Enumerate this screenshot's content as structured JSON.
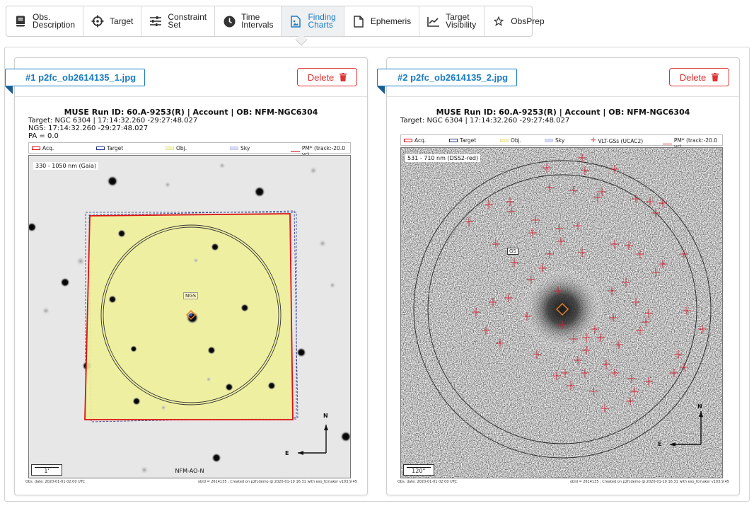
{
  "tabs": [
    {
      "label": "Obs.\nDescription",
      "icon": "book-icon"
    },
    {
      "label": "Target",
      "icon": "crosshair-icon"
    },
    {
      "label": "Constraint\nSet",
      "icon": "sliders-icon"
    },
    {
      "label": "Time\nIntervals",
      "icon": "clock-icon"
    },
    {
      "label": "Finding\nCharts",
      "icon": "image-file-icon"
    },
    {
      "label": "Ephemeris",
      "icon": "file-icon"
    },
    {
      "label": "Target\nVisibility",
      "icon": "line-chart-icon"
    },
    {
      "label": "ObsPrep",
      "icon": "star-icon"
    }
  ],
  "active_tab": "Finding Charts",
  "colors": {
    "accent": "#1b7cc2",
    "danger": "#dd3333",
    "acq": "#d11",
    "target": "#223388",
    "obj": "#f0ef9a",
    "sky": "#c8cdf0",
    "gs": "#cc2233"
  },
  "cards": [
    {
      "name": "#1 p2fc_ob2614135_1.jpg",
      "delete_label": "Delete",
      "title": "MUSE Run ID: 60.A-9253(R) | Account | OB: NFM-NGC6304",
      "lines": [
        "Target: NGC  6304 | 17:14:32.260 -29:27:48.027",
        "NGS: 17:14:32.260 -29:27:48.027",
        "PA = 0.0"
      ],
      "legend": [
        "Acq.",
        "Target",
        "Obj.",
        "Sky",
        "PM* (track:-20.0 yr)"
      ],
      "band": "330 - 1050 nm (Gaia)",
      "star_label": "NGS",
      "scale": "1'",
      "note": "NFM-AO-N",
      "compass_n": "N",
      "compass_e": "E",
      "footer_left": "Obs. date: 2020-01-01 02:00 UTC",
      "footer_right": "obId = 2614135 ; Created on p2fcdemo @ 2020-01-10 16:31  with eso_fcmaker v103.9.45"
    },
    {
      "name": "#2 p2fc_ob2614135_2.jpg",
      "delete_label": "Delete",
      "title": "MUSE Run ID: 60.A-9253(R) | Account | OB: NFM-NGC6304",
      "lines": [
        "Target: NGC  6304 | 17:14:32.260 -29:27:48.027"
      ],
      "legend": [
        "Acq.",
        "Target",
        "Obj.",
        "Sky",
        "VLT-GSs (UCAC2)",
        "PM* (track:-20.0 yr)"
      ],
      "band": "531 - 710 nm (DSS2-red)",
      "star_label": "GS",
      "scale": "120''",
      "compass_n": "N",
      "compass_e": "E",
      "footer_left": "Obs. date: 2020-01-01 02:00 UTC",
      "footer_right": "obId = 2614135 ; Created on p2fcdemo @ 2020-01-10 16:31  with eso_fcmaker v103.9.45"
    }
  ]
}
